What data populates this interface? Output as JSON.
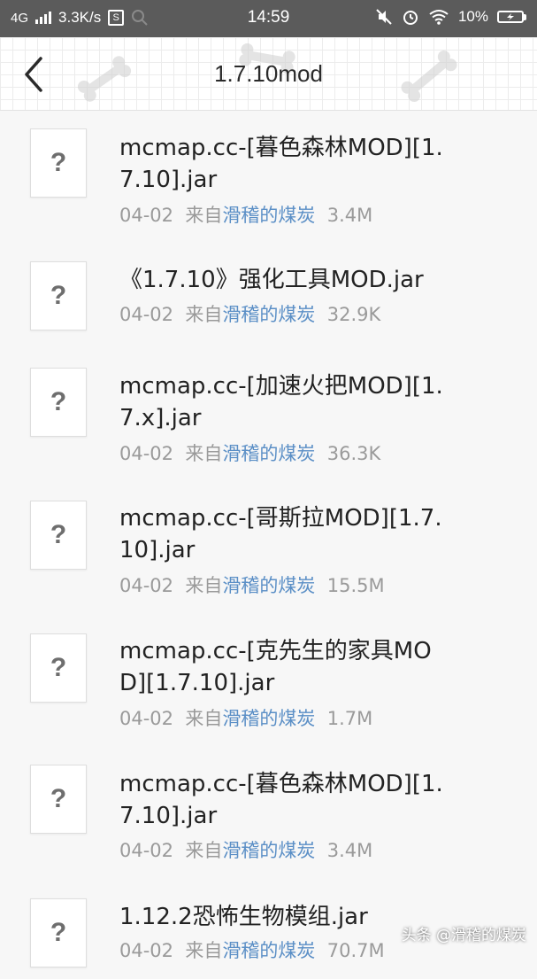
{
  "status_bar": {
    "network": "4G",
    "speed": "3.3K/s",
    "s_badge": "S",
    "time": "14:59",
    "battery": "10%",
    "icons": [
      "signal-icon",
      "search-icon",
      "mute-icon",
      "alarm-icon",
      "wifi-icon",
      "battery-icon"
    ]
  },
  "header": {
    "title": "1.7.10mod",
    "back_icon": "chevron-left-icon"
  },
  "files": [
    {
      "icon": "?",
      "name": "mcmap.cc-[暮色森林MOD][1.7.10].jar",
      "date": "04-02",
      "from_label": "来自",
      "sender": "滑稽的煤炭",
      "size": "3.4M"
    },
    {
      "icon": "?",
      "name": "《1.7.10》强化工具MOD.jar",
      "date": "04-02",
      "from_label": "来自",
      "sender": "滑稽的煤炭",
      "size": "32.9K"
    },
    {
      "icon": "?",
      "name": "mcmap.cc-[加速火把MOD][1.7.x].jar",
      "date": "04-02",
      "from_label": "来自",
      "sender": "滑稽的煤炭",
      "size": "36.3K"
    },
    {
      "icon": "?",
      "name": "mcmap.cc-[哥斯拉MOD][1.7.10].jar",
      "date": "04-02",
      "from_label": "来自",
      "sender": "滑稽的煤炭",
      "size": "15.5M"
    },
    {
      "icon": "?",
      "name": "mcmap.cc-[克先生的家具MOD][1.7.10].jar",
      "date": "04-02",
      "from_label": "来自",
      "sender": "滑稽的煤炭",
      "size": "1.7M"
    },
    {
      "icon": "?",
      "name": "mcmap.cc-[暮色森林MOD][1.7.10].jar",
      "date": "04-02",
      "from_label": "来自",
      "sender": "滑稽的煤炭",
      "size": "3.4M"
    },
    {
      "icon": "?",
      "name": "1.12.2恐怖生物模组.jar",
      "date": "04-02",
      "from_label": "来自",
      "sender": "滑稽的煤炭",
      "size": "70.7M"
    }
  ],
  "watermark": "头条 @滑稽的煤炭",
  "colors": {
    "status_bar_bg": "#5b5b5b",
    "sender_link": "#5b8fc6",
    "meta_text": "#9a9a9a",
    "title_text": "#222222"
  }
}
